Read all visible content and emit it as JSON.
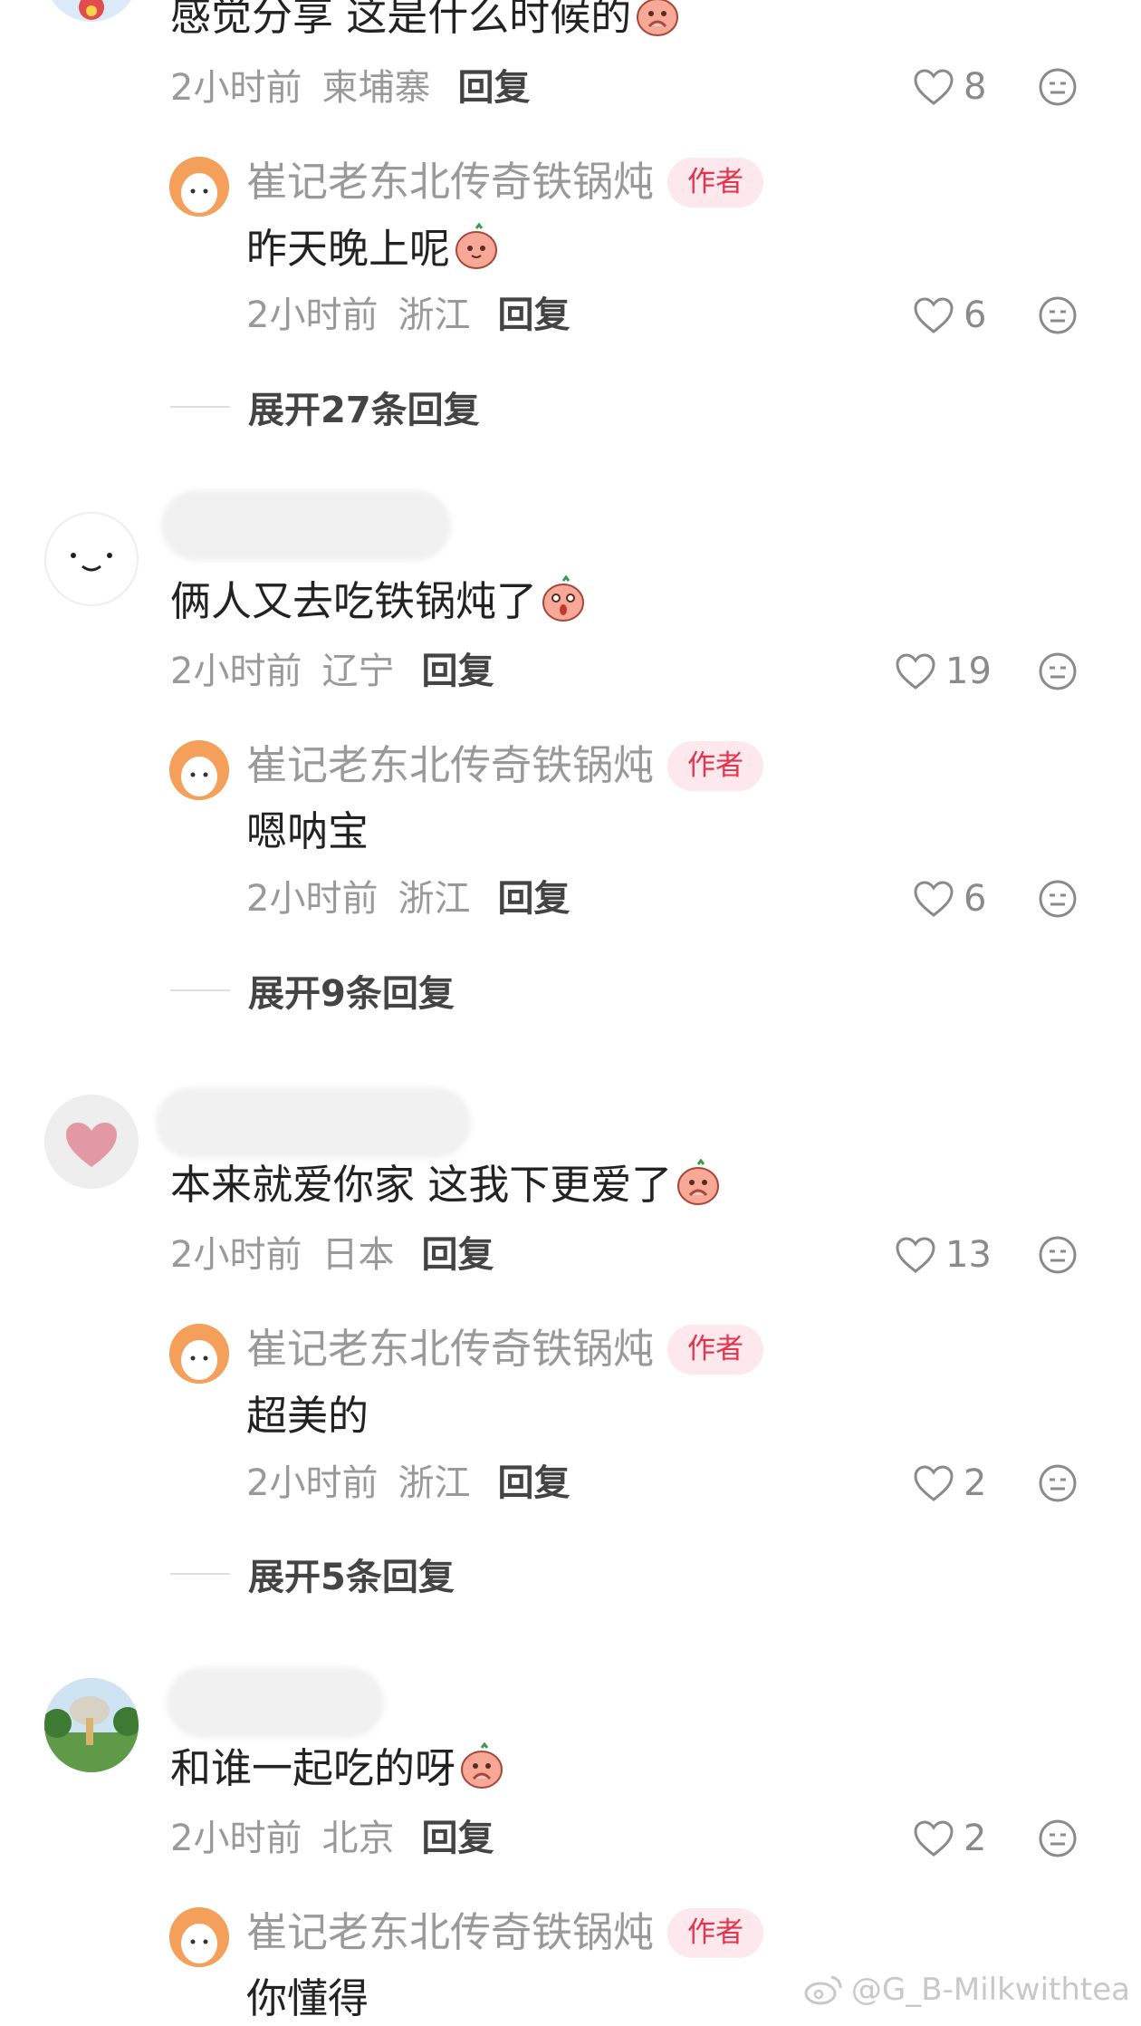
{
  "reply_label": "回复",
  "author_badge": "作者",
  "author_name": "崔记老东北传奇铁锅炖",
  "comments": [
    {
      "text": "感觉分享 这是什么时候的",
      "time": "2小时前",
      "location": "柬埔寨",
      "likes": "8",
      "reply": {
        "text": "昨天晚上呢",
        "time": "2小时前",
        "location": "浙江",
        "likes": "6"
      },
      "expand_text": "展开27条回复"
    },
    {
      "text": "俩人又去吃铁锅炖了",
      "time": "2小时前",
      "location": "辽宁",
      "likes": "19",
      "reply": {
        "text": "嗯呐宝",
        "time": "2小时前",
        "location": "浙江",
        "likes": "6"
      },
      "expand_text": "展开9条回复"
    },
    {
      "text": "本来就爱你家 这我下更爱了",
      "time": "2小时前",
      "location": "日本",
      "likes": "13",
      "reply": {
        "text": "超美的",
        "time": "2小时前",
        "location": "浙江",
        "likes": "2"
      },
      "expand_text": "展开5条回复"
    },
    {
      "text": "和谁一起吃的呀",
      "time": "2小时前",
      "location": "北京",
      "likes": "2",
      "reply": {
        "text": "你懂得"
      }
    }
  ],
  "watermark": "@G_B-Milkwithtea",
  "colors": {
    "author_badge_bg": "#fde8ee",
    "author_badge_text": "#e4334b",
    "meta_text": "#999999"
  }
}
